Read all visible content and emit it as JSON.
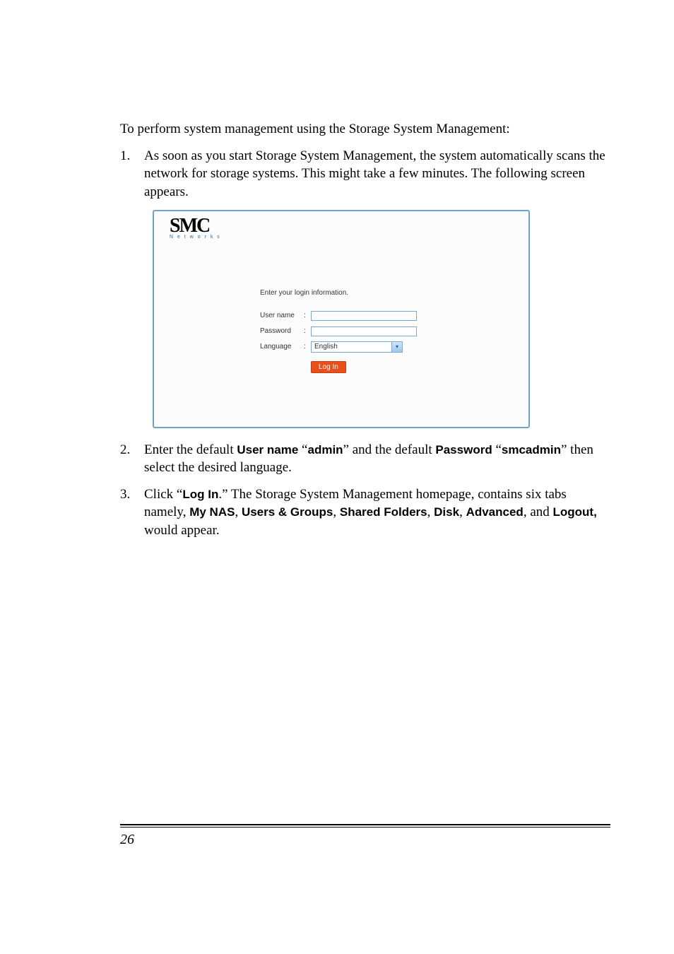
{
  "intro": "To perform system management using the Storage System Management:",
  "steps": [
    {
      "num": "1.",
      "text_before": "As soon as you start Storage System Management, the system automatically scans the network for storage systems. This might take a few minutes. The following screen appears."
    },
    {
      "num": "2.",
      "parts": [
        {
          "t": "plain",
          "v": "Enter the default "
        },
        {
          "t": "bold",
          "v": "User name"
        },
        {
          "t": "plain",
          "v": " “"
        },
        {
          "t": "bold",
          "v": "admin"
        },
        {
          "t": "plain",
          "v": "” and the default "
        },
        {
          "t": "bold",
          "v": "Password"
        },
        {
          "t": "plain",
          "v": " “"
        },
        {
          "t": "bold",
          "v": "smcadmin"
        },
        {
          "t": "plain",
          "v": "” then select the desired language."
        }
      ]
    },
    {
      "num": "3.",
      "parts": [
        {
          "t": "plain",
          "v": "Click “"
        },
        {
          "t": "bold",
          "v": "Log In"
        },
        {
          "t": "plain",
          "v": ".” The Storage System Management homepage, contains six tabs namely, "
        },
        {
          "t": "bold",
          "v": "My NAS"
        },
        {
          "t": "plain",
          "v": ", "
        },
        {
          "t": "bold",
          "v": "Users & Groups"
        },
        {
          "t": "plain",
          "v": ", "
        },
        {
          "t": "bold",
          "v": "Shared Folders"
        },
        {
          "t": "plain",
          "v": ", "
        },
        {
          "t": "bold",
          "v": "Disk"
        },
        {
          "t": "plain",
          "v": ", "
        },
        {
          "t": "bold",
          "v": "Advanced"
        },
        {
          "t": "plain",
          "v": ", and "
        },
        {
          "t": "bold",
          "v": "Logout,"
        },
        {
          "t": "plain",
          "v": " would appear."
        }
      ]
    }
  ],
  "login_screen": {
    "logo_main": "SMC",
    "logo_sub": "N e t w o r k s",
    "title": "Enter your login information.",
    "username_label": "User name",
    "password_label": "Password",
    "language_label": "Language",
    "colon": ":",
    "language_value": "English",
    "login_button": "Log In"
  },
  "page_number": "26"
}
